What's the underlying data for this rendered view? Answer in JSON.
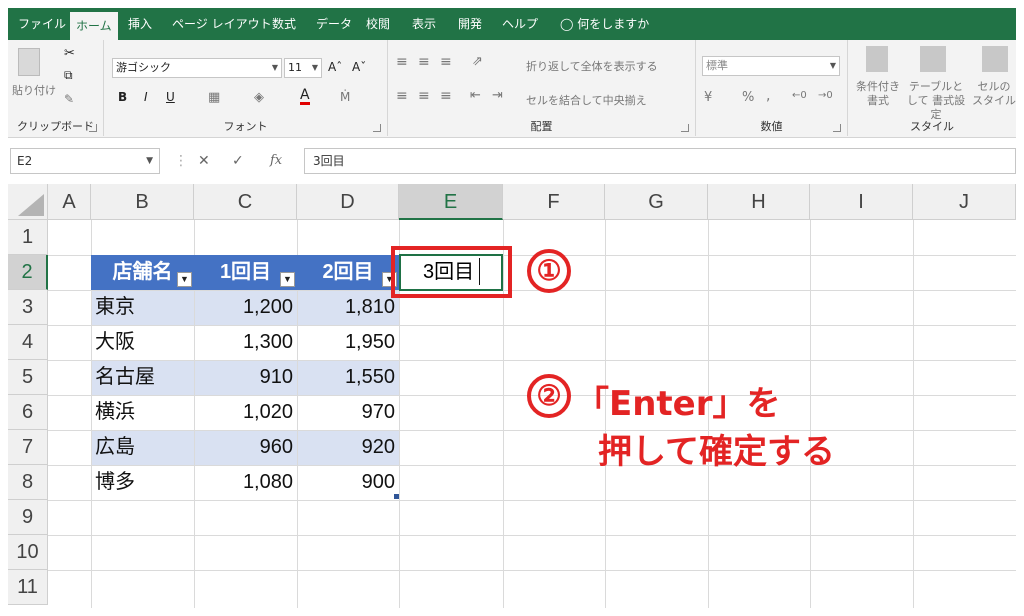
{
  "tabs": [
    "ファイル",
    "ホーム",
    "挿入",
    "ページ レイアウト",
    "数式",
    "データ",
    "校閲",
    "表示",
    "開発",
    "ヘルプ"
  ],
  "tell_me": "何をしますか",
  "ribbon": {
    "clipboard": {
      "paste": "貼り付け",
      "label": "クリップボード"
    },
    "font": {
      "name": "游ゴシック",
      "size": "11",
      "label": "フォント",
      "bold": "B",
      "italic": "I",
      "underline": "U"
    },
    "align": {
      "wrap": "折り返して全体を表示する",
      "merge": "セルを結合して中央揃え",
      "label": "配置"
    },
    "number": {
      "format": "標準",
      "label": "数値",
      "percent": "%"
    },
    "styles": {
      "cond": "条件付き 書式",
      "table": "テーブルとして 書式設定",
      "cell": "セルの スタイル",
      "label": "スタイル"
    }
  },
  "formula_bar": {
    "name_box": "E2",
    "content": "3回目"
  },
  "columns": [
    "A",
    "B",
    "C",
    "D",
    "E",
    "F",
    "G",
    "H",
    "I",
    "J"
  ],
  "rows": [
    "1",
    "2",
    "3",
    "4",
    "5",
    "6",
    "7",
    "8",
    "9",
    "10",
    "11"
  ],
  "table": {
    "headers": [
      "店舗名",
      "1回目",
      "2回目"
    ],
    "rows": [
      [
        "東京",
        "1,200",
        "1,810"
      ],
      [
        "大阪",
        "1,300",
        "1,950"
      ],
      [
        "名古屋",
        "910",
        "1,550"
      ],
      [
        "横浜",
        "1,020",
        "970"
      ],
      [
        "広島",
        "960",
        "920"
      ],
      [
        "博多",
        "1,080",
        "900"
      ]
    ]
  },
  "active_cell_text": "3回目",
  "annotations": {
    "step1": "①",
    "step2": "②",
    "step2_line1": "「Enter」を",
    "step2_line2": "押して確定する"
  },
  "colors": {
    "excel_green": "#217346",
    "table_header": "#4472c4",
    "band": "#d9e1f2",
    "annotation_red": "#e32424"
  }
}
